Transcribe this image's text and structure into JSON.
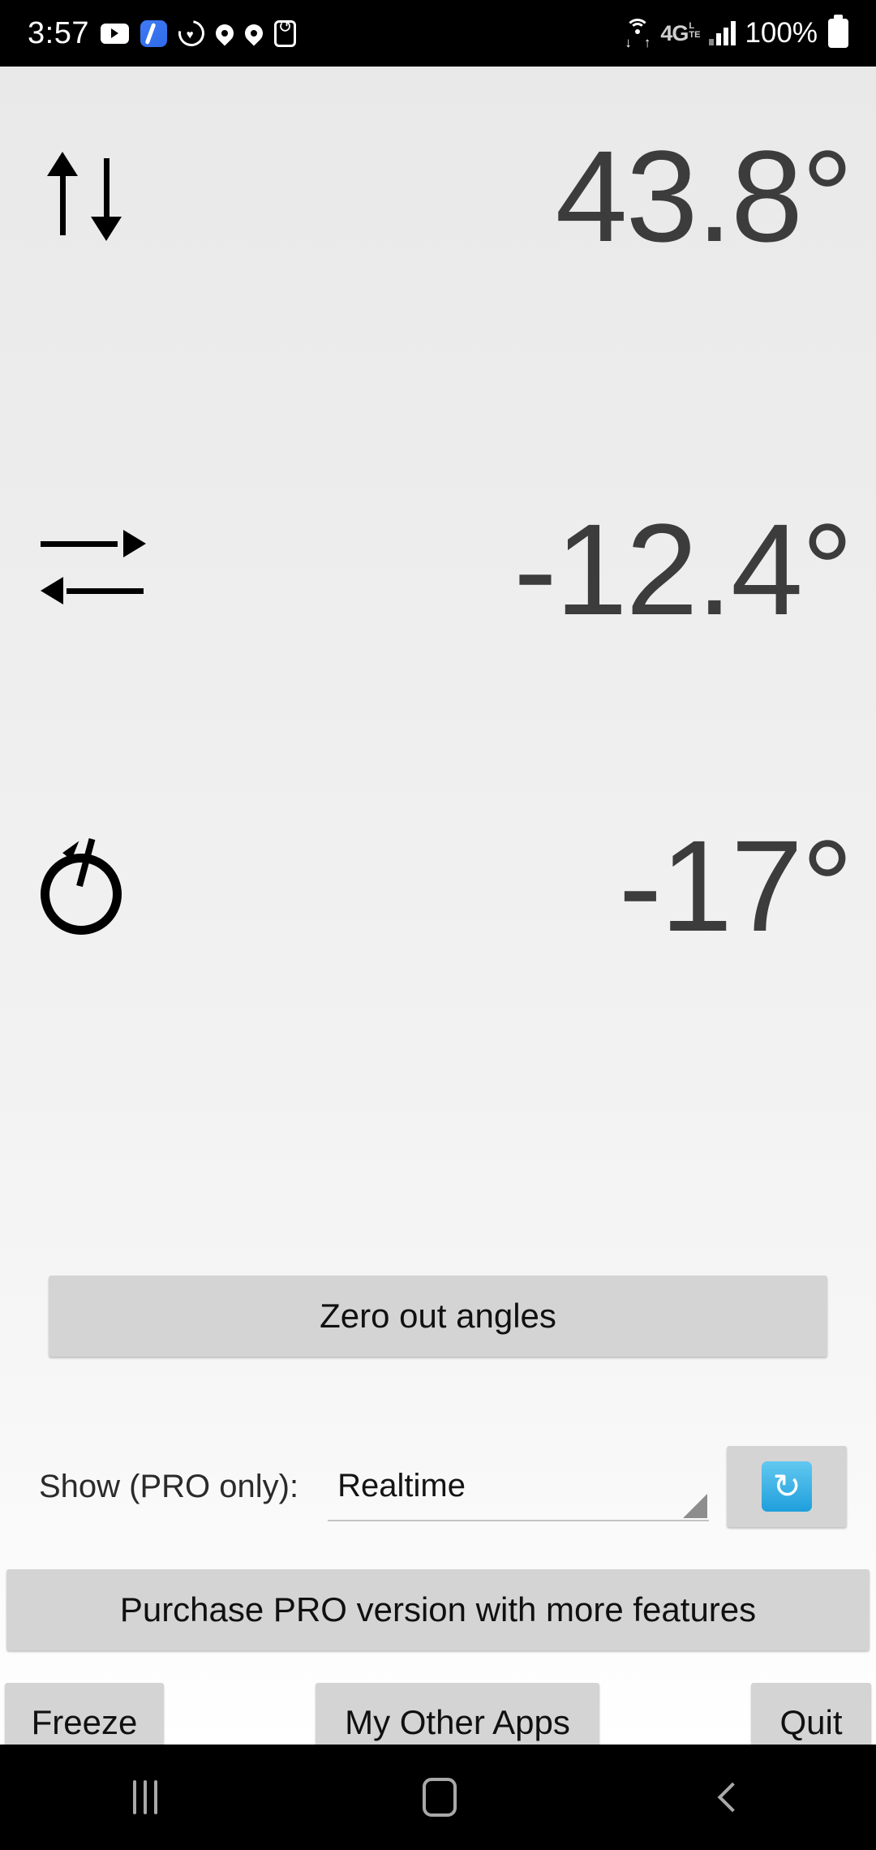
{
  "status_bar": {
    "time": "3:57",
    "left_icons": [
      "youtube-icon",
      "blue-app-icon",
      "heart-health-icon",
      "location-pin-icon",
      "location-pin-icon-2",
      "reset-timer-icon"
    ],
    "wifi_icon": "wifi-icon",
    "network_label": "4G",
    "network_sub_top": "L",
    "network_sub_bottom": "TE",
    "signal_icon": "signal-bars-icon",
    "battery_percent": "100%",
    "battery_icon": "battery-full-icon"
  },
  "readouts": [
    {
      "icon": "pitch-updown-arrows-icon",
      "label": "pitch",
      "value": "43.8°"
    },
    {
      "icon": "roll-leftright-arrows-icon",
      "label": "roll",
      "value": "-12.4°"
    },
    {
      "icon": "azimuth-rotation-icon",
      "label": "azimuth",
      "value": "-17°"
    }
  ],
  "controls": {
    "zero_button": "Zero out angles",
    "show_label": "Show (PRO only):",
    "show_value": "Realtime",
    "show_options": [
      "Realtime"
    ],
    "refresh_icon": "refresh-sync-icon",
    "pro_button": "Purchase PRO version with more features",
    "freeze_button": "Freeze",
    "other_apps_button": "My Other Apps",
    "quit_button": "Quit"
  },
  "nav_bar": {
    "recents_icon": "recents-icon",
    "home_icon": "home-icon",
    "back_icon": "back-icon"
  },
  "colors": {
    "value_text": "#3c3c3c",
    "button_bg": "#d4d4d4",
    "refresh_accent": "#1f9fdc",
    "spinner_arrow": "#8d8d8d"
  }
}
